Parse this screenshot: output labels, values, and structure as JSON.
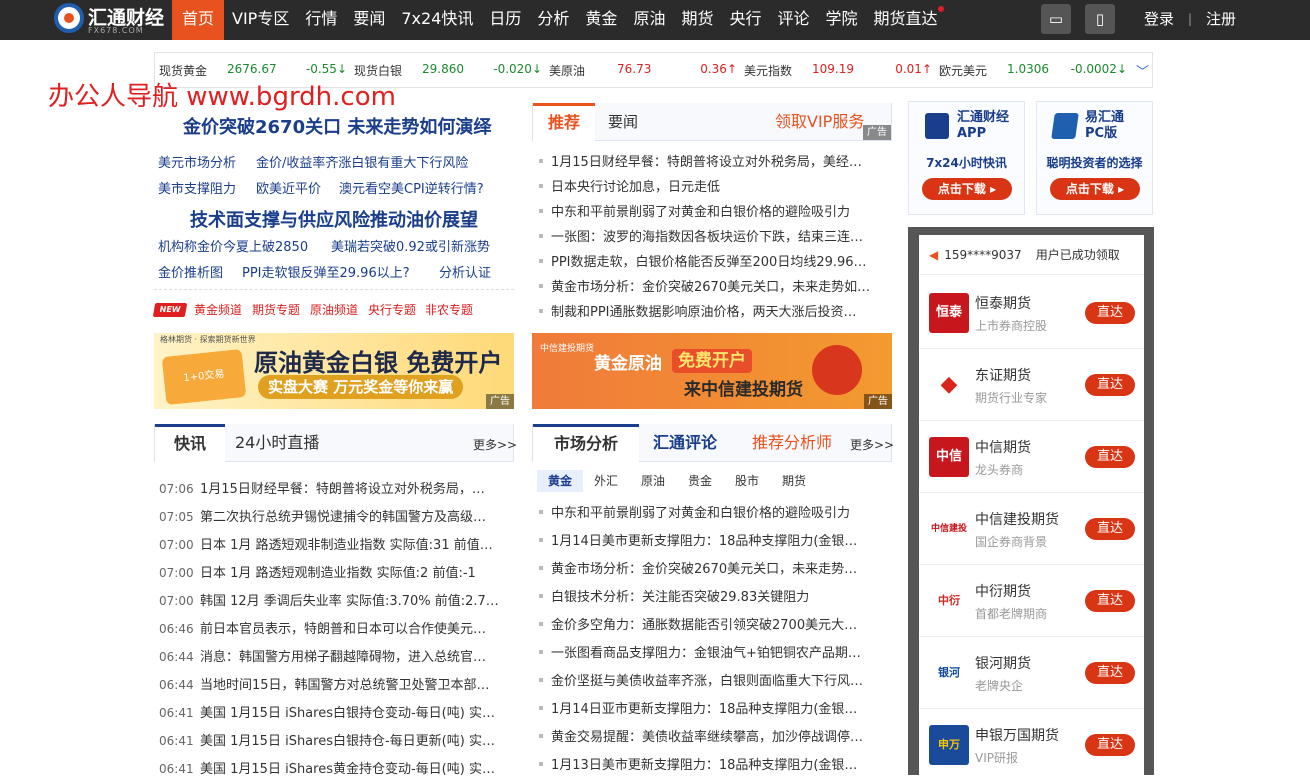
{
  "header": {
    "logo_text": "汇通财经",
    "logo_sub": "FX678.COM",
    "nav": [
      "首页",
      "VIP专区",
      "行情",
      "要闻",
      "7x24快讯",
      "日历",
      "分析",
      "黄金",
      "原油",
      "期货",
      "央行",
      "评论",
      "学院",
      "期货直达"
    ],
    "login": "登录",
    "register": "注册",
    "sep": "|"
  },
  "ticker": [
    {
      "name": "现货黄金",
      "price": "2676.67",
      "change": "-0.55",
      "dir": "down"
    },
    {
      "name": "现货白银",
      "price": "29.860",
      "change": "-0.020",
      "dir": "down"
    },
    {
      "name": "美原油",
      "price": "76.73",
      "change": "0.36",
      "dir": "up"
    },
    {
      "name": "美元指数",
      "price": "109.19",
      "change": "0.01",
      "dir": "up"
    },
    {
      "name": "欧元美元",
      "price": "1.0306",
      "change": "-0.0002",
      "dir": "down"
    }
  ],
  "watermark": "办公人导航 www.bgrdh.com",
  "left": {
    "headline1": "金价突破2670关口 未来走势如何演绎",
    "links1": [
      "美元市场分析",
      "金价/收益率齐涨白银有重大下行风险",
      "美市支撑阻力",
      "欧美近平价",
      "澳元看空美CPI逆转行情?"
    ],
    "headline2": "技术面支撑与供应风险推动油价展望",
    "links2": [
      "机构称金价今夏上破2850",
      "美瑞若突破0.92或引新涨势",
      "金价推析图",
      "PPI走软银反弹至29.96以上?",
      "分析认证"
    ],
    "new_badge": "NEW",
    "channels": [
      "黄金频道",
      "期货专题",
      "原油频道",
      "央行专题",
      "非农专题"
    ]
  },
  "ad1": {
    "small": "格林期货 · 探索期货新世界",
    "main": "原油黄金白银 免费开户",
    "sub": "实盘大赛 万元奖金等你来赢",
    "chip": "1+0交易",
    "tag": "广告"
  },
  "ad2": {
    "brand": "中信建投期货",
    "main1": "黄金原油",
    "main2": "免费开户",
    "sub": "来中信建投期货",
    "tag": "广告"
  },
  "rec": {
    "tab1": "推荐",
    "tab2": "要闻",
    "vip": "领取VIP服务",
    "tag": "广告",
    "items": [
      "1月15日财经早餐：特朗普将设立对外税务局，美经…",
      "日本央行讨论加息，日元走低",
      "中东和平前景削弱了对黄金和白银价格的避险吸引力",
      "一张图：波罗的海指数因各板块运价下跌，结束三连…",
      "PPI数据走软，白银价格能否反弹至200日均线29.96…",
      "黄金市场分析：金价突破2670美元关口，未来走势如…",
      "制裁和PPI通胀数据影响原油价格，两天大涨后投资…"
    ]
  },
  "flash": {
    "tab1": "快讯",
    "tab2": "24小时直播",
    "more": "更多>>",
    "items": [
      {
        "time": "07:06",
        "text": "1月15日财经早餐：特朗普将设立对外税务局，…"
      },
      {
        "time": "07:05",
        "text": "第二次执行总统尹锡悦逮捕令的韩国警方及高级…"
      },
      {
        "time": "07:00",
        "text": "日本 1月 路透短观非制造业指数 实际值:31 前值…"
      },
      {
        "time": "07:00",
        "text": "日本 1月 路透短观制造业指数 实际值:2 前值:-1"
      },
      {
        "time": "07:00",
        "text": "韩国 12月 季调后失业率 实际值:3.70% 前值:2.7…"
      },
      {
        "time": "06:46",
        "text": "前日本官员表示，特朗普和日本可以合作使美元…"
      },
      {
        "time": "06:44",
        "text": "消息：韩国警方用梯子翻越障碍物，进入总统官…"
      },
      {
        "time": "06:44",
        "text": "当地时间15日，韩国警方对总统警卫处警卫本部…"
      },
      {
        "time": "06:41",
        "text": "美国 1月15日 iShares白银持仓变动-每日(吨) 实…"
      },
      {
        "time": "06:41",
        "text": "美国 1月15日 iShares白银持仓-每日更新(吨) 实…"
      },
      {
        "time": "06:41",
        "text": "美国 1月15日 iShares黄金持仓变动-每日(吨) 实…"
      }
    ]
  },
  "market": {
    "tab1": "市场分析",
    "tab2": "汇通评论",
    "tab3": "推荐分析师",
    "more": "更多>>",
    "subtabs": [
      "黄金",
      "外汇",
      "原油",
      "贵金",
      "股市",
      "期货"
    ],
    "items": [
      "中东和平前景削弱了对黄金和白银价格的避险吸引力",
      "1月14日美市更新支撑阻力：18品种支撑阻力(金银…",
      "黄金市场分析：金价突破2670美元关口，未来走势…",
      "白银技术分析：关注能否突破29.83关键阻力",
      "金价多空角力：通胀数据能否引领突破2700美元大…",
      "一张图看商品支撑阻力：金银油气+铂钯铜农产品期…",
      "金价坚挺与美债收益率齐涨，白银则面临重大下行风…",
      "1月14日亚市更新支撑阻力：18品种支撑阻力(金银…",
      "黄金交易提醒：美债收益率继续攀高，加沙停战调停…",
      "1月13日美市更新支撑阻力：18品种支撑阻力(金银…"
    ]
  },
  "apps": [
    {
      "title1": "汇通财经",
      "title2": "APP",
      "sub": "7x24小时快讯",
      "btn": "点击下载"
    },
    {
      "title1": "易汇通",
      "title2": "PC版",
      "sub": "聪明投资者的选择",
      "btn": "点击下载"
    }
  ],
  "partners": {
    "notice_phone": "159****9037",
    "notice_text": "用户已成功领取",
    "btn": "直达",
    "items": [
      {
        "name": "恒泰期货",
        "desc": "上市券商控股",
        "logo": "恒泰",
        "color": "#c8161d"
      },
      {
        "name": "东证期货",
        "desc": "期货行业专家",
        "logo": "◆",
        "color": "#d9261c"
      },
      {
        "name": "中信期货",
        "desc": "龙头券商",
        "logo": "中信",
        "color": "#c8161d"
      },
      {
        "name": "中信建投期货",
        "desc": "国企券商背景",
        "logo": "中信建投",
        "color": "#c8161d"
      },
      {
        "name": "中衍期货",
        "desc": "首都老牌期商",
        "logo": "中衍",
        "color": "#d9261c"
      },
      {
        "name": "银河期货",
        "desc": "老牌央企",
        "logo": "银河",
        "color": "#0d4aa0"
      },
      {
        "name": "申银万国期货",
        "desc": "VIP研报",
        "logo": "申万",
        "color": "#1a4a9a"
      }
    ]
  },
  "colors": {
    "accent": "#e8521e",
    "navy": "#1a3e8c",
    "up": "#e02020",
    "down": "#1a8a2e"
  }
}
